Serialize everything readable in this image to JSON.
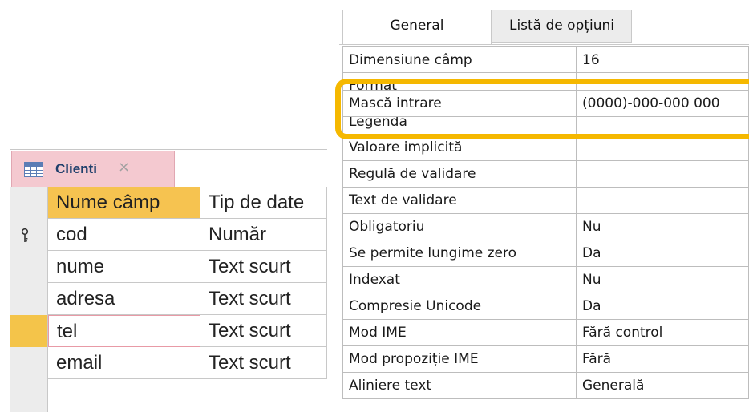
{
  "object_tab": {
    "title": "Clienti",
    "close_glyph": "×",
    "icon": "table-icon"
  },
  "grid": {
    "headers": {
      "field_name": "Nume câmp",
      "data_type": "Tip de date"
    },
    "rows": [
      {
        "name": "cod",
        "type": "Număr",
        "primary_key": true
      },
      {
        "name": "nume",
        "type": "Text scurt"
      },
      {
        "name": "adresa",
        "type": "Text scurt"
      },
      {
        "name": "tel",
        "type": "Text scurt",
        "selected": true
      },
      {
        "name": "email",
        "type": "Text scurt"
      }
    ]
  },
  "properties": {
    "tabs": [
      "General",
      "Listă de opțiuni"
    ],
    "rows": [
      {
        "label": "Dimensiune câmp",
        "value": "16"
      },
      {
        "label": "Format",
        "value": ""
      },
      {
        "label": "Mască intrare",
        "value": "(0000)-000-000 000"
      },
      {
        "label": "Legendă",
        "value": ""
      },
      {
        "label": "Valoare implicită",
        "value": ""
      },
      {
        "label": "Regulă de validare",
        "value": ""
      },
      {
        "label": "Text de validare",
        "value": ""
      },
      {
        "label": "Obligatoriu",
        "value": "Nu"
      },
      {
        "label": "Se permite lungime zero",
        "value": "Da"
      },
      {
        "label": "Indexat",
        "value": "Nu"
      },
      {
        "label": "Compresie Unicode",
        "value": "Da"
      },
      {
        "label": "Mod IME",
        "value": "Fără control"
      },
      {
        "label": "Mod propoziție IME",
        "value": "Fără"
      },
      {
        "label": "Aliniere text",
        "value": "Generală"
      }
    ]
  },
  "colors": {
    "callout": "#f5b800",
    "selected_row": "#f4c44a",
    "tab_background": "#f4c9d0"
  }
}
